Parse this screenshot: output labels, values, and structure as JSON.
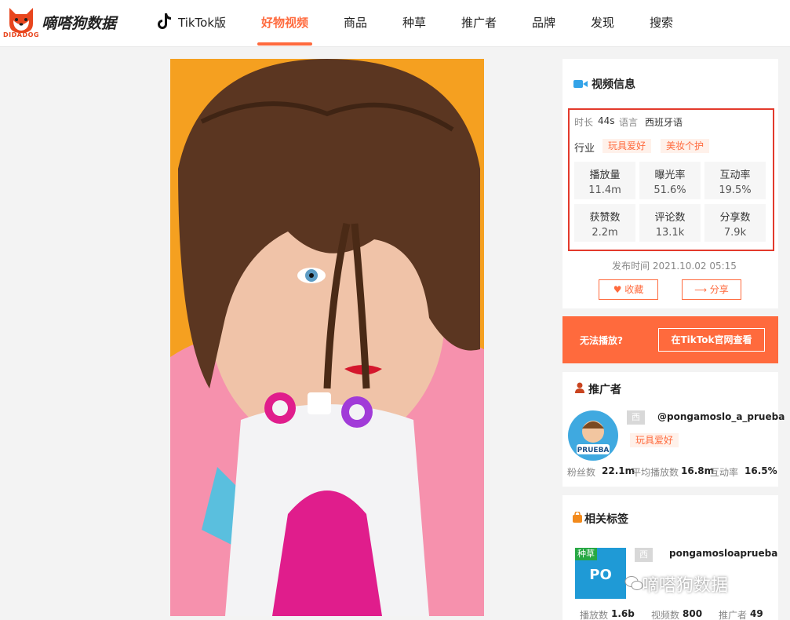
{
  "header": {
    "logo_caption": "DIDADOG",
    "brand": "嘀嗒狗数据",
    "nav": [
      "TikTok版",
      "好物视频",
      "商品",
      "种草",
      "推广者",
      "品牌",
      "发现",
      "搜索"
    ],
    "active_index": 1
  },
  "video_info": {
    "title": "视频信息",
    "duration_label": "时长",
    "duration": "44s",
    "language_label": "语言",
    "language": "西班牙语",
    "industry_label": "行业",
    "industry_tags": [
      "玩具爱好",
      "美妆个护"
    ],
    "stats": [
      {
        "label": "播放量",
        "value": "11.4m"
      },
      {
        "label": "曝光率",
        "value": "51.6%"
      },
      {
        "label": "互动率",
        "value": "19.5%"
      },
      {
        "label": "获赞数",
        "value": "2.2m"
      },
      {
        "label": "评论数",
        "value": "13.1k"
      },
      {
        "label": "分享数",
        "value": "7.9k"
      }
    ],
    "publish_time": "发布时间 2021.10.02 05:15",
    "favorite_label": "收藏",
    "share_label": "分享"
  },
  "cannot_play": {
    "question": "无法播放?",
    "button": "在TikTok官网查看"
  },
  "promoter": {
    "title": "推广者",
    "region_chip": "西",
    "handle": "@pongamoslo_a_prueba",
    "tag": "玩具爱好",
    "avatar_text": "PRUEBA",
    "fans_label": "粉丝数",
    "fans": "22.1m",
    "avg_play_label": "平均播放数",
    "avg_play": "16.8m",
    "engagement_label": "互动率",
    "engagement": "16.5%"
  },
  "related": {
    "title": "相关标签",
    "badge": "种草",
    "thumb_text": "PO",
    "region_chip": "西",
    "name": "pongamosloaprueba",
    "plays_label": "播放数",
    "plays": "1.6b",
    "videos_label": "视频数",
    "videos": "800",
    "promoters_label": "推广者",
    "promoters": "49"
  },
  "watermark": "嘀嗒狗数据",
  "colors": {
    "accent": "#ff6a3d",
    "highlight_box": "#e33a2c",
    "video_bg": "#f5a020"
  }
}
